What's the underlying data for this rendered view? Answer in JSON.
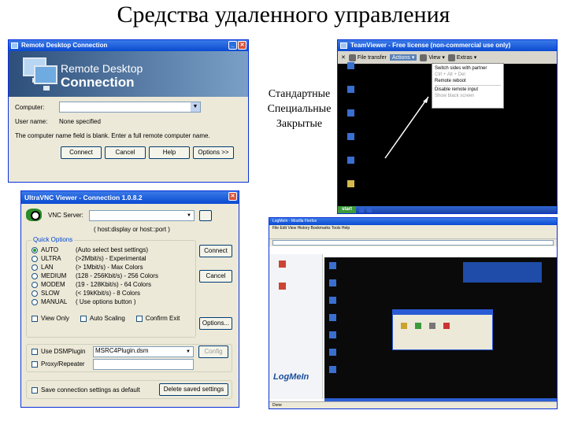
{
  "slide": {
    "title": "Средства удаленного управления",
    "bullets": [
      "Стандартные",
      "Специальные",
      "Закрытые"
    ]
  },
  "rdp": {
    "window_title": "Remote Desktop Connection",
    "banner_line1": "Remote Desktop",
    "banner_line2": "Connection",
    "computer_label": "Computer:",
    "computer_value": "",
    "username_label": "User name:",
    "username_value": "None specified",
    "note": "The computer name field is blank. Enter a full remote computer name.",
    "buttons": [
      "Connect",
      "Cancel",
      "Help",
      "Options >>"
    ]
  },
  "teamviewer": {
    "window_title": "TeamViewer - Free license (non-commercial use only)",
    "toolbar": [
      "File transfer",
      "Actions",
      "View",
      "Extras"
    ],
    "menu": [
      "Switch sides with partner",
      "Ctrl + Alt + Del",
      "Remote reboot",
      "Disable remote input",
      "Show black screen"
    ],
    "taskbar_start": "start"
  },
  "vnc": {
    "window_title": "UltraVNC Viewer - Connection 1.0.8.2",
    "server_label": "VNC Server:",
    "server_hint": "( host:display or host::port )",
    "quick_options_label": "Quick Options",
    "options": [
      {
        "name": "AUTO",
        "desc": "(Auto select best settings)"
      },
      {
        "name": "ULTRA",
        "desc": "(>2Mbit/s) - Experimental"
      },
      {
        "name": "LAN",
        "desc": "(> 1Mbit/s) - Max Colors"
      },
      {
        "name": "MEDIUM",
        "desc": "(128 - 256Kbit/s) - 256 Colors"
      },
      {
        "name": "MODEM",
        "desc": "(19 - 128Kbit/s) - 64 Colors"
      },
      {
        "name": "SLOW",
        "desc": "(< 19kKbit/s) - 8 Colors"
      },
      {
        "name": "MANUAL",
        "desc": "( Use options button )"
      }
    ],
    "view_only": "View Only",
    "auto_scaling": "Auto Scaling",
    "confirm_exit": "Confirm Exit",
    "use_dsm": "Use DSMPlugin",
    "dsm_value": "MSRC4Plugin.dsm",
    "config_button": "Config",
    "proxy": "Proxy/Repeater",
    "save_label": "Save connection settings as default",
    "delete_button": "Delete saved settings",
    "connect_button": "Connect",
    "cancel_button": "Cancel",
    "options_button": "Options..."
  },
  "logmein": {
    "window_title": "LogMeIn - Mozilla Firefox",
    "menu": "File  Edit  View  History  Bookmarks  Tools  Help",
    "logo": "LogMeIn",
    "status": "Done"
  },
  "colors": {
    "xp_blue": "#0a4ad1",
    "rdp_banner": "#2d4f7a",
    "tv_menu_highlight": "#5b82b8"
  }
}
